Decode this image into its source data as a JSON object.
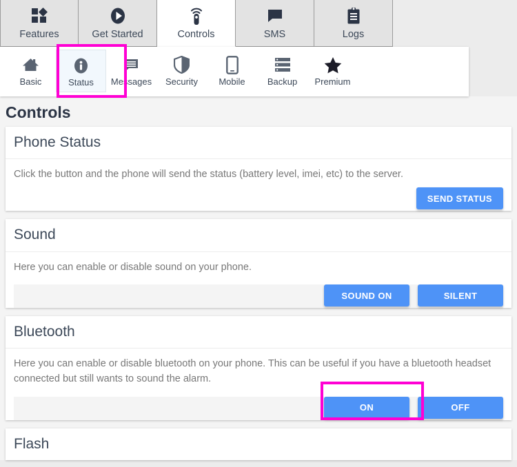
{
  "main_tabs": [
    {
      "label": "Features",
      "icon": "widgets-icon",
      "active": false
    },
    {
      "label": "Get Started",
      "icon": "play-circle-icon",
      "active": false
    },
    {
      "label": "Controls",
      "icon": "remote-control-icon",
      "active": true
    },
    {
      "label": "SMS",
      "icon": "chat-bubble-icon",
      "active": false
    },
    {
      "label": "Logs",
      "icon": "clipboard-icon",
      "active": false
    }
  ],
  "sub_tabs": [
    {
      "label": "Basic",
      "icon": "home-icon",
      "active": false,
      "highlighted": false
    },
    {
      "label": "Status",
      "icon": "info-circle-icon",
      "active": true,
      "highlighted": true
    },
    {
      "label": "Messages",
      "icon": "message-lines-icon",
      "active": false,
      "highlighted": false
    },
    {
      "label": "Security",
      "icon": "shield-icon",
      "active": false,
      "highlighted": false
    },
    {
      "label": "Mobile",
      "icon": "phone-icon",
      "active": false,
      "highlighted": false
    },
    {
      "label": "Backup",
      "icon": "server-stack-icon",
      "active": false,
      "highlighted": false
    },
    {
      "label": "Premium",
      "icon": "star-icon",
      "active": false,
      "highlighted": false
    }
  ],
  "page": {
    "title": "Controls"
  },
  "sections": {
    "phone_status": {
      "title": "Phone Status",
      "description": "Click the button and the phone will send the status (battery level, imei, etc) to the server.",
      "buttons": [
        {
          "label": "SEND STATUS",
          "name": "send-status-button",
          "highlighted": false
        }
      ]
    },
    "sound": {
      "title": "Sound",
      "description": "Here you can enable or disable sound on your phone.",
      "buttons": [
        {
          "label": "SOUND ON",
          "name": "sound-on-button",
          "highlighted": false
        },
        {
          "label": "SILENT",
          "name": "silent-button",
          "highlighted": false
        }
      ]
    },
    "bluetooth": {
      "title": "Bluetooth",
      "description": "Here you can enable or disable bluetooth on your phone. This can be useful if you have a bluetooth headset connected but still wants to sound the alarm.",
      "buttons": [
        {
          "label": "ON",
          "name": "bluetooth-on-button",
          "highlighted": true
        },
        {
          "label": "OFF",
          "name": "bluetooth-off-button",
          "highlighted": false
        }
      ]
    },
    "flash": {
      "title": "Flash"
    }
  },
  "colors": {
    "button_blue": "#4e93f7",
    "highlight_magenta": "#ff00d4",
    "page_background": "#f4f4f4",
    "chrome_background": "#ececec",
    "icon_dark": "#3c4858"
  }
}
